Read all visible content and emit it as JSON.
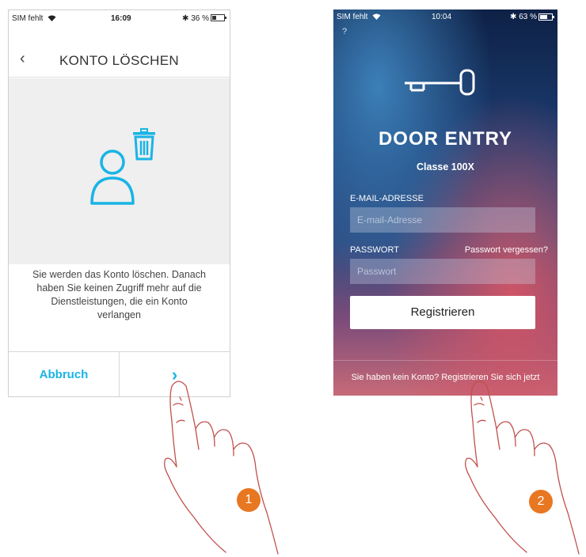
{
  "phone1": {
    "status": {
      "carrier": "SIM fehlt",
      "time": "16:09",
      "battery": "36 %",
      "battery_level": 0.36
    },
    "header": {
      "title": "KONTO LÖSCHEN"
    },
    "message": [
      "Sie werden das Konto löschen. Danach",
      "haben Sie keinen Zugriff mehr auf die",
      "Dienstleistungen, die ein Konto",
      "verlangen"
    ],
    "footer": {
      "cancel_label": "Abbruch"
    }
  },
  "phone2": {
    "status": {
      "carrier": "SIM fehlt",
      "time": "10:04",
      "battery": "63 %",
      "battery_level": 0.63
    },
    "help": "?",
    "title": "DOOR ENTRY",
    "subtitle": "Classe 100X",
    "email": {
      "label": "E-MAIL-ADRESSE",
      "placeholder": "E-mail-Adresse",
      "value": ""
    },
    "password": {
      "label": "PASSWORT",
      "placeholder": "Passwort",
      "value": "",
      "forgot": "Passwort vergessen?"
    },
    "register_label": "Registrieren",
    "bottom_link": "Sie haben kein Konto? Registrieren Sie sich jetzt"
  },
  "callouts": [
    "1",
    "2"
  ],
  "colors": {
    "accent": "#19b4e6",
    "badge": "#e87722",
    "hand_stroke": "#c0504d"
  }
}
